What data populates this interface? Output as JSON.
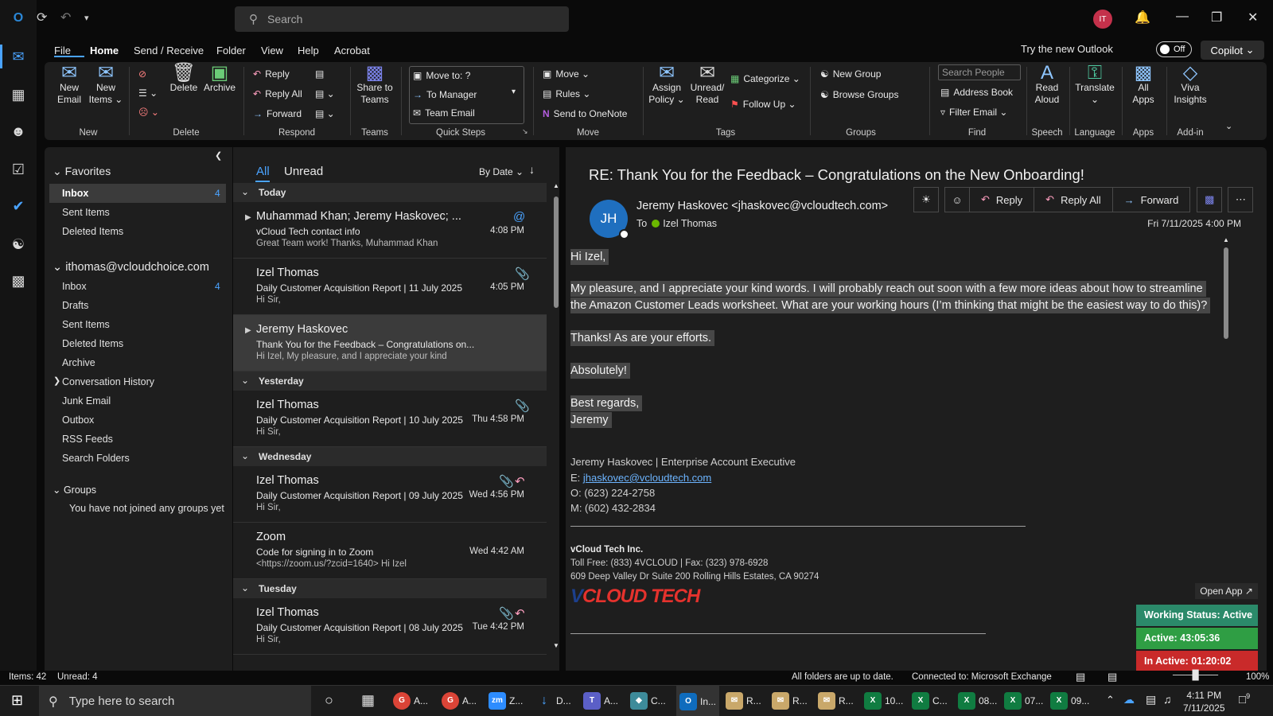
{
  "app": {
    "search_placeholder": "Search",
    "user_initials": "IT",
    "try_new_outlook": "Try the new Outlook",
    "toggle_state": "Off",
    "copilot": "Copilot"
  },
  "menu": [
    "File",
    "Home",
    "Send / Receive",
    "Folder",
    "View",
    "Help",
    "Acrobat"
  ],
  "ribbon": {
    "new_email": [
      "New",
      "Email"
    ],
    "new_items": [
      "New",
      "Items ⌄"
    ],
    "delete": "Delete",
    "archive": "Archive",
    "reply": "Reply",
    "reply_all": "Reply All",
    "forward": "Forward",
    "share_to_teams": [
      "Share to",
      "Teams"
    ],
    "move_to": "Move to: ?",
    "to_manager": "To Manager",
    "team_email": "Team Email",
    "move": "Move ⌄",
    "rules": "Rules ⌄",
    "send_to_onenote": "Send to OneNote",
    "assign_policy": [
      "Assign",
      "Policy ⌄"
    ],
    "unread_read": [
      "Unread/",
      "Read"
    ],
    "categorize": "Categorize ⌄",
    "follow_up": "Follow Up ⌄",
    "new_group": "New Group",
    "browse_groups": "Browse Groups",
    "search_people_placeholder": "Search People",
    "address_book": "Address Book",
    "filter_email": "Filter Email ⌄",
    "read_aloud": [
      "Read",
      "Aloud"
    ],
    "translate": [
      "Translate",
      "⌄"
    ],
    "all_apps": [
      "All",
      "Apps"
    ],
    "viva_insights": [
      "Viva",
      "Insights"
    ],
    "groups": [
      "New",
      "Delete",
      "Respond",
      "Teams",
      "Quick Steps",
      "Move",
      "Tags",
      "Groups",
      "Find",
      "Speech",
      "Language",
      "Apps",
      "Add-in"
    ]
  },
  "folders": {
    "favorites_label": "Favorites",
    "favorites": [
      {
        "name": "Inbox",
        "count": "4"
      },
      {
        "name": "Sent Items",
        "count": ""
      },
      {
        "name": "Deleted Items",
        "count": ""
      }
    ],
    "account": "ithomas@vcloudchoice.com",
    "account_items": [
      {
        "name": "Inbox",
        "count": "4"
      },
      {
        "name": "Drafts",
        "count": ""
      },
      {
        "name": "Sent Items",
        "count": ""
      },
      {
        "name": "Deleted Items",
        "count": ""
      },
      {
        "name": "Archive",
        "count": ""
      },
      {
        "name": "Conversation History",
        "count": ""
      },
      {
        "name": "Junk Email",
        "count": ""
      },
      {
        "name": "Outbox",
        "count": ""
      },
      {
        "name": "RSS Feeds",
        "count": ""
      },
      {
        "name": "Search Folders",
        "count": ""
      }
    ],
    "groups_label": "Groups",
    "groups_note": "You have not joined any groups yet"
  },
  "list": {
    "tab_all": "All",
    "tab_unread": "Unread",
    "sort": "By Date",
    "sections": [
      "Today",
      "Yesterday",
      "Wednesday",
      "Tuesday"
    ],
    "messages": [
      {
        "sender": "Muhammad Khan;  Jeremy Haskovec;  ...",
        "subject": "vCloud Tech contact info",
        "preview": "Great Team work!   Thanks,  Muhammad Khan",
        "time": "4:08 PM"
      },
      {
        "sender": "Izel Thomas",
        "subject": "Daily Customer Acquisition Report | 11 July 2025",
        "preview": "Hi Sir,",
        "time": "4:05 PM"
      },
      {
        "sender": "Jeremy Haskovec",
        "subject": "Thank You for the Feedback – Congratulations on...",
        "preview": "Hi Izel,  My pleasure, and I appreciate your kind",
        "time": ""
      },
      {
        "sender": "Izel Thomas",
        "subject": "Daily Customer Acquisition Report | 10 July 2025",
        "preview": "Hi Sir,",
        "time": "Thu 4:58 PM"
      },
      {
        "sender": "Izel Thomas",
        "subject": "Daily Customer Acquisition Report | 09 July 2025",
        "preview": "Hi Sir,",
        "time": "Wed 4:56 PM"
      },
      {
        "sender": "Zoom",
        "subject": "Code for signing in to Zoom",
        "preview": "<https://zoom.us/?zcid=1640>          Hi Izel",
        "time": "Wed 4:42 AM"
      },
      {
        "sender": "Izel Thomas",
        "subject": "Daily Customer Acquisition Report | 08 July 2025",
        "preview": "Hi Sir,",
        "time": "Tue 4:42 PM"
      }
    ]
  },
  "reading": {
    "subject": "RE: Thank You for the Feedback – Congratulations on the New Onboarding!",
    "avatar": "JH",
    "from": "Jeremy Haskovec <jhaskovec@vcloudtech.com>",
    "to_label": "To",
    "to": "Izel Thomas",
    "date": "Fri 7/11/2025 4:00 PM",
    "actions": {
      "reply": "Reply",
      "reply_all": "Reply All",
      "forward": "Forward"
    },
    "body": {
      "greeting": "Hi Izel,",
      "p1_line1": "My pleasure, and I appreciate your kind words.  I will probably reach out soon with a few more ideas about how to streamline",
      "p1_line2": "the Amazon Customer Leads worksheet.  What are your working hours (I’m thinking that might be the easiest way to do this)?",
      "p2": "Thanks! As are your efforts.",
      "p3": "Absolutely!",
      "closing": "Best regards,",
      "name": "Jeremy"
    },
    "signature": {
      "line": "Jeremy Haskovec | Enterprise Account Executive",
      "email_label": "E: ",
      "email": "jhaskovec@vcloudtech.com",
      "office": "O: (623) 224-2758",
      "mobile": "M: (602) 432-2834",
      "company": "vCloud Tech Inc.",
      "tollfree": "Toll Free: (833) 4VCLOUD | Fax: (323) 978-6928",
      "address": "609 Deep Valley Dr Suite 200 Rolling Hills Estates, CA 90274",
      "logo_v": "V",
      "logo_rest": "CLOUD TECH"
    }
  },
  "widget": {
    "open_app": "Open App ↗",
    "status": "Working Status: Active",
    "active": "Active: 43:05:36",
    "inactive": "In Active: 01:20:02"
  },
  "status": {
    "items": "Items: 42",
    "unread": "Unread: 4",
    "sync": "All folders are up to date.",
    "connection": "Connected to: Microsoft Exchange",
    "zoom": "100%"
  },
  "taskbar": {
    "search_placeholder": "Type here to search",
    "apps": [
      "A...",
      "A...",
      "Z...",
      "D...",
      "A...",
      "C...",
      "In...",
      "R...",
      "R...",
      "R...",
      "10...",
      "C...",
      "08...",
      "07...",
      "09..."
    ],
    "time": "4:11 PM",
    "date": "7/11/2025",
    "notifications": "9"
  },
  "colors": {
    "accent": "#4aa3ff",
    "active_green": "#2f9e44",
    "inactive_red": "#c92a2a",
    "status_teal": "#2b8a6a"
  }
}
